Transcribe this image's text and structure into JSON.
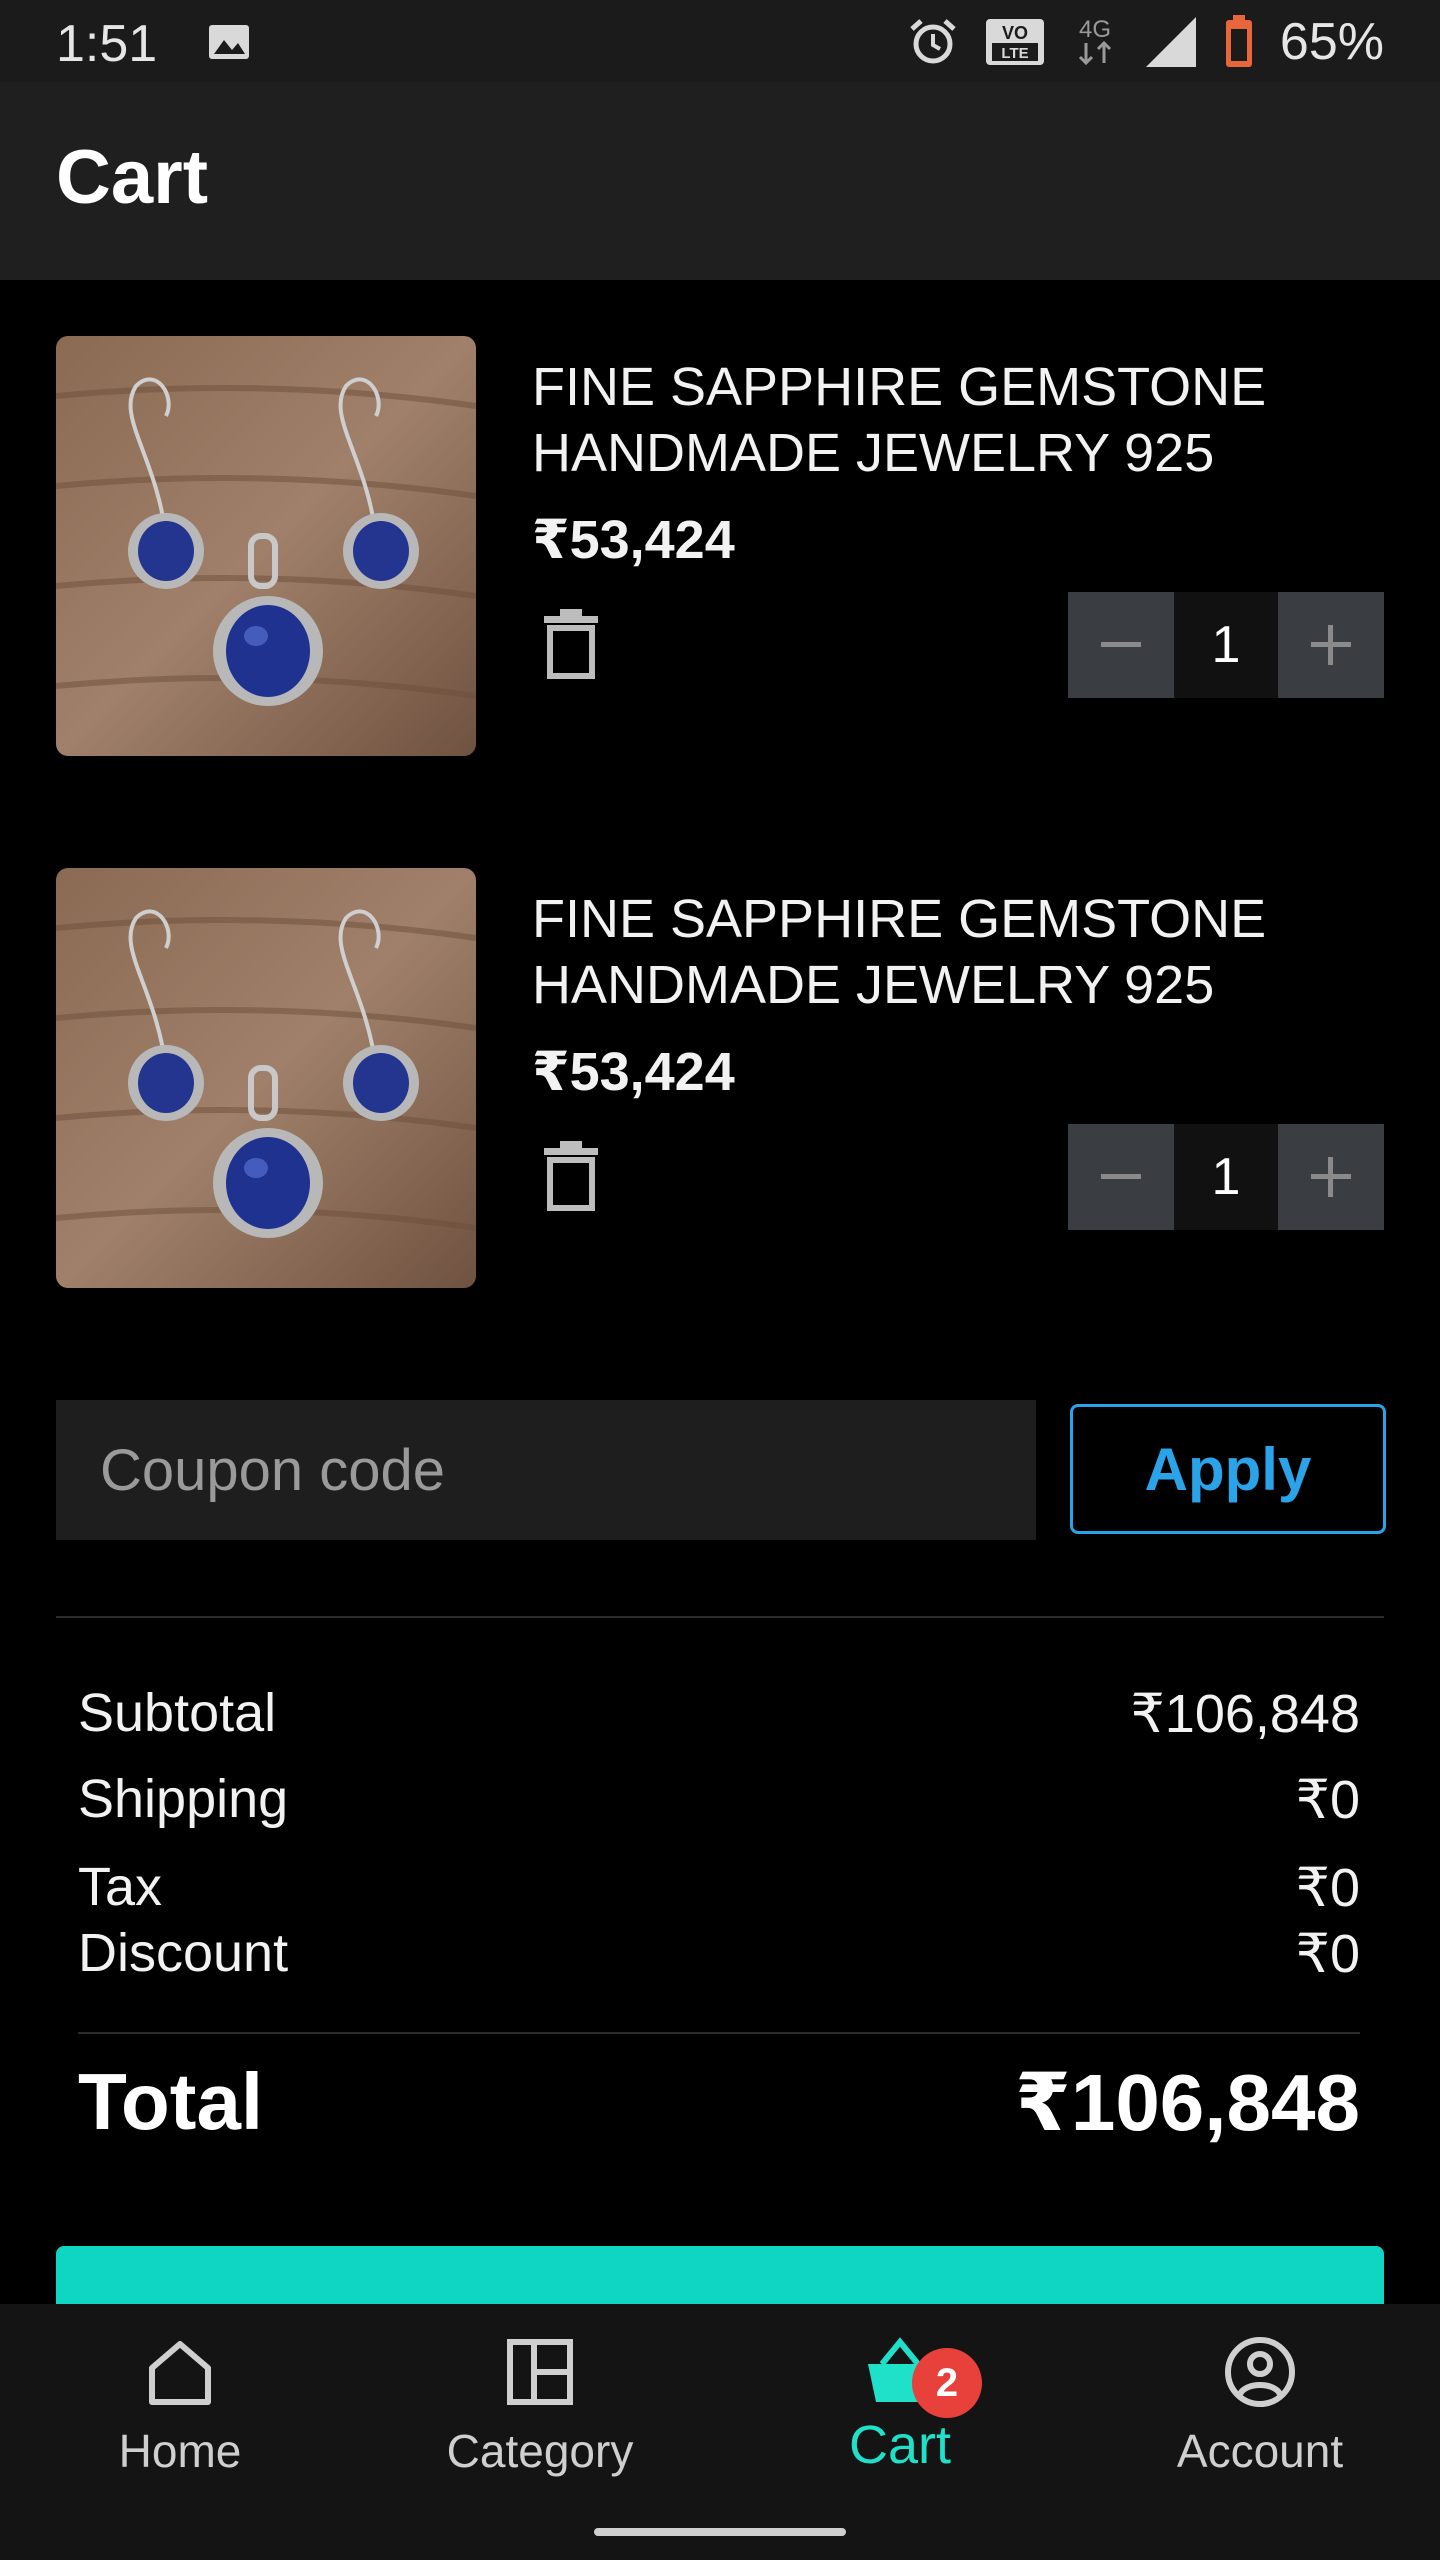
{
  "status_bar": {
    "time": "1:51",
    "icons": [
      "image-icon",
      "alarm-icon",
      "volte-icon",
      "4g-icon",
      "signal-icon",
      "battery-icon"
    ],
    "network": "4G",
    "volte": "VO LTE",
    "battery": "65%"
  },
  "header": {
    "title": "Cart"
  },
  "items": [
    {
      "name": "FINE SAPPHIRE GEMSTONE HANDMADE JEWELRY 925",
      "price": "₹53,424",
      "quantity": "1"
    },
    {
      "name": "FINE SAPPHIRE GEMSTONE HANDMADE JEWELRY 925",
      "price": "₹53,424",
      "quantity": "1"
    }
  ],
  "coupon": {
    "placeholder": "Coupon code",
    "apply_label": "Apply"
  },
  "summary": {
    "subtotal_label": "Subtotal",
    "subtotal": "₹106,848",
    "shipping_label": "Shipping",
    "shipping": "₹0",
    "tax_label": "Tax",
    "tax": "₹0",
    "discount_label": "Discount",
    "discount": "₹0",
    "total_label": "Total",
    "total": "₹106,848"
  },
  "nav": {
    "home": "Home",
    "category": "Category",
    "cart": "Cart",
    "cart_badge": "2",
    "account": "Account"
  },
  "colors": {
    "accent": "#0fd6c2",
    "link": "#2aa3e8",
    "badge": "#e8413c",
    "background": "#000000"
  }
}
